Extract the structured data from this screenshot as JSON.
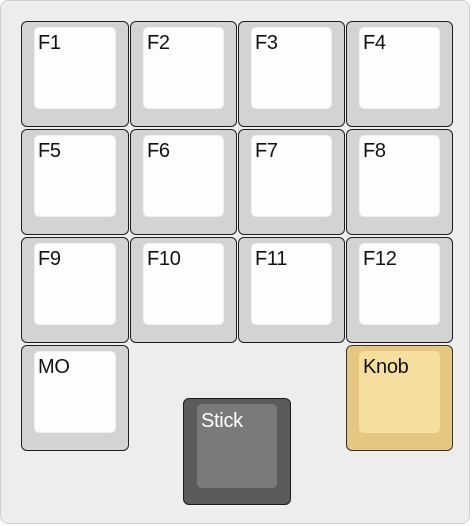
{
  "keypad": {
    "keys": [
      {
        "label": "F1"
      },
      {
        "label": "F2"
      },
      {
        "label": "F3"
      },
      {
        "label": "F4"
      },
      {
        "label": "F5"
      },
      {
        "label": "F6"
      },
      {
        "label": "F7"
      },
      {
        "label": "F8"
      },
      {
        "label": "F9"
      },
      {
        "label": "F10"
      },
      {
        "label": "F11"
      },
      {
        "label": "F12"
      }
    ],
    "mo": {
      "label": "MO"
    },
    "knob": {
      "label": "Knob",
      "color": "#f6df9e"
    },
    "stick": {
      "label": "Stick",
      "color": "#7a7a7a"
    }
  }
}
